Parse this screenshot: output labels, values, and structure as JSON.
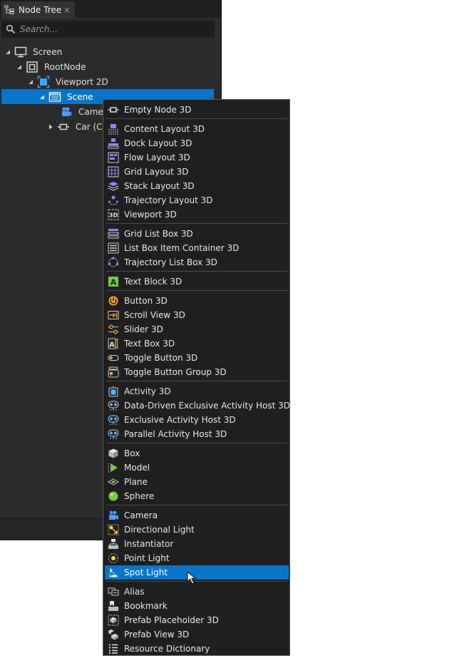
{
  "panel": {
    "tab": {
      "title": "Node Tree",
      "close": "×",
      "icon": "node-tree-icon"
    },
    "search": {
      "placeholder": "Search..."
    },
    "tree": [
      {
        "label": "Screen",
        "icon": "screen-icon",
        "level": 0,
        "expanded": true
      },
      {
        "label": "RootNode",
        "icon": "root-node-icon",
        "level": 1,
        "expanded": true
      },
      {
        "label": "Viewport 2D",
        "icon": "viewport-2d-icon",
        "level": 2,
        "expanded": true
      },
      {
        "label": "Scene",
        "icon": "scene-icon",
        "level": 3,
        "expanded": true,
        "selected": true
      },
      {
        "label": "Camer",
        "icon": "camera-icon",
        "level": 4
      },
      {
        "label": "Car (C",
        "icon": "empty-node-icon",
        "level": 4,
        "collapsed": true
      }
    ]
  },
  "menu": {
    "groups": [
      [
        {
          "label": "Empty Node 3D",
          "icon": "empty-node-icon"
        }
      ],
      [
        {
          "label": "Content Layout 3D",
          "icon": "content-layout-icon"
        },
        {
          "label": "Dock Layout 3D",
          "icon": "dock-layout-icon"
        },
        {
          "label": "Flow Layout 3D",
          "icon": "flow-layout-icon"
        },
        {
          "label": "Grid Layout 3D",
          "icon": "grid-layout-icon"
        },
        {
          "label": "Stack Layout 3D",
          "icon": "stack-layout-icon"
        },
        {
          "label": "Trajectory Layout 3D",
          "icon": "trajectory-layout-icon"
        },
        {
          "label": "Viewport 3D",
          "icon": "viewport-3d-icon"
        }
      ],
      [
        {
          "label": "Grid List Box 3D",
          "icon": "grid-list-box-icon"
        },
        {
          "label": "List Box Item Container 3D",
          "icon": "list-box-item-icon"
        },
        {
          "label": "Trajectory List Box 3D",
          "icon": "trajectory-list-box-icon"
        }
      ],
      [
        {
          "label": "Text Block 3D",
          "icon": "text-block-icon"
        }
      ],
      [
        {
          "label": "Button 3D",
          "icon": "button-icon"
        },
        {
          "label": "Scroll View 3D",
          "icon": "scroll-view-icon"
        },
        {
          "label": "Slider 3D",
          "icon": "slider-icon"
        },
        {
          "label": "Text Box 3D",
          "icon": "text-box-icon"
        },
        {
          "label": "Toggle Button 3D",
          "icon": "toggle-button-icon"
        },
        {
          "label": "Toggle Button Group 3D",
          "icon": "toggle-button-group-icon"
        }
      ],
      [
        {
          "label": "Activity 3D",
          "icon": "activity-icon"
        },
        {
          "label": "Data-Driven Exclusive Activity Host 3D",
          "icon": "activity-host-icon"
        },
        {
          "label": "Exclusive Activity Host 3D",
          "icon": "activity-host-icon"
        },
        {
          "label": "Parallel Activity Host 3D",
          "icon": "activity-host-icon"
        }
      ],
      [
        {
          "label": "Box",
          "icon": "box-icon"
        },
        {
          "label": "Model",
          "icon": "model-icon"
        },
        {
          "label": "Plane",
          "icon": "plane-icon"
        },
        {
          "label": "Sphere",
          "icon": "sphere-icon"
        }
      ],
      [
        {
          "label": "Camera",
          "icon": "camera-icon"
        },
        {
          "label": "Directional Light",
          "icon": "directional-light-icon"
        },
        {
          "label": "Instantiator",
          "icon": "instantiator-icon"
        },
        {
          "label": "Point Light",
          "icon": "point-light-icon"
        },
        {
          "label": "Spot Light",
          "icon": "spot-light-icon",
          "active": true
        }
      ],
      [
        {
          "label": "Alias",
          "icon": "alias-icon"
        },
        {
          "label": "Bookmark",
          "icon": "bookmark-icon"
        },
        {
          "label": "Prefab Placeholder 3D",
          "icon": "prefab-placeholder-icon"
        },
        {
          "label": "Prefab View 3D",
          "icon": "prefab-view-icon"
        },
        {
          "label": "Resource Dictionary",
          "icon": "resource-dictionary-icon"
        }
      ]
    ]
  },
  "colors": {
    "panel_bg": "#2b2b2b",
    "menu_bg": "#1f1f1f",
    "selection": "#0a74c8",
    "icon_purple": "#8c88ff",
    "icon_orange": "#f0a030",
    "icon_green": "#7ac943"
  }
}
